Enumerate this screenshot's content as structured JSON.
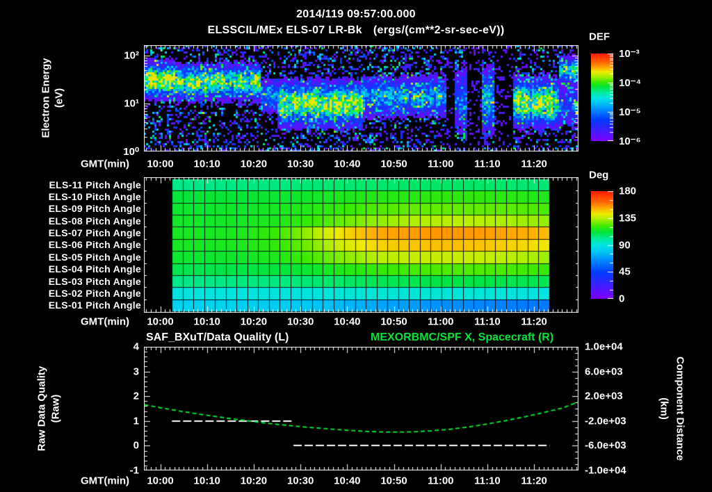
{
  "header": {
    "datetime": "2014/119 09:57:00.000",
    "instrument": "ELSSCIL/MEx ELS-07 LR-Bk",
    "units": "(ergs/(cm**2-sr-sec-eV))"
  },
  "colors": {
    "text": "#ffffff",
    "green": "#00e63c",
    "background": "#000000"
  },
  "time_axis": {
    "label": "GMT(min)",
    "tick_labels": [
      "10:00",
      "10:10",
      "10:20",
      "10:30",
      "10:40",
      "10:50",
      "11:00",
      "11:10",
      "11:20"
    ],
    "major_tick_minutes": [
      600,
      610,
      620,
      630,
      640,
      650,
      660,
      670,
      680
    ],
    "minor_tick_every_min": 1,
    "tmin_min": 596.5,
    "tmax_min": 689.5
  },
  "spectrogram_panel": {
    "ylabel_line1": "Electron Energy",
    "ylabel_line2": "(eV)",
    "ytick_labels": [
      "10²",
      "10¹",
      "10⁰"
    ],
    "ytick_decades": [
      2,
      1,
      0
    ],
    "colorbar_title": "DEF",
    "colorbar_tick_labels": [
      "10⁻³",
      "10⁻⁴",
      "10⁻⁵",
      "10⁻⁶"
    ]
  },
  "pitch_panel": {
    "row_labels": [
      "ELS-11 Pitch Angle",
      "ELS-10 Pitch Angle",
      "ELS-09 Pitch Angle",
      "ELS-08 Pitch Angle",
      "ELS-07 Pitch Angle",
      "ELS-06 Pitch Angle",
      "ELS-05 Pitch Angle",
      "ELS-04 Pitch Angle",
      "ELS-03 Pitch Angle",
      "ELS-02 Pitch Angle",
      "ELS-01 Pitch Angle"
    ],
    "colorbar_title": "Deg",
    "colorbar_tick_labels": [
      "180",
      "135",
      "90",
      "45",
      "0"
    ],
    "grid_columns": 35
  },
  "bottom_panel": {
    "title_left": "SAF_BXuT/Data Quality (L)",
    "title_right": "MEXORBMC/SPF X, Spacecraft (R)",
    "ylabel_left_line1": "Raw Data Quality",
    "ylabel_left_line2": "(Raw)",
    "ylabel_right_line1": "Component Distance",
    "ylabel_right_line2": "(km)",
    "left_tick_labels": [
      "4",
      "3",
      "2",
      "1",
      "0",
      "-1"
    ],
    "right_tick_labels": [
      "1.0e+04",
      "6.0e+03",
      "2.0e+03",
      "-2.0e+03",
      "-6.0e+03",
      "-1.0e+04"
    ]
  },
  "chart_data": [
    {
      "type": "heatmap",
      "id": "electron-energy-spectrogram",
      "title": "ELSSCIL/MEx ELS-07 LR-Bk",
      "z_units": "ergs/(cm**2-sr-sec-eV)",
      "x_axis": "GMT",
      "x_range_hhmm": [
        "09:57",
        "11:29"
      ],
      "y_axis": "Electron Energy (eV)",
      "y_scale": "log",
      "y_range_ev": [
        1,
        165
      ],
      "z_scale": "log",
      "z_range": [
        1e-06,
        0.001
      ],
      "features": [
        {
          "t_min": [
            596.5,
            603.0
          ],
          "energy_ev": [
            15,
            62
          ],
          "amplitude": 0.92,
          "note": "brightest yellow-green band at start"
        },
        {
          "t_min": [
            603.0,
            621.5
          ],
          "energy_ev": [
            14,
            55
          ],
          "amplitude": 0.78,
          "note": "green band ~20-50 eV"
        },
        {
          "t_min": [
            621.5,
            625.2
          ],
          "energy_ev": [
            7,
            28
          ],
          "amplitude": 0.38,
          "note": "weak cyan transition"
        },
        {
          "t_min": [
            625.2,
            643.5
          ],
          "energy_ev": [
            4,
            24
          ],
          "amplitude": 0.85,
          "note": "strong low-energy green block"
        },
        {
          "t_min": [
            643.5,
            661.4
          ],
          "energy_ev": [
            6,
            32
          ],
          "amplitude": 0.47,
          "note": "diffuse cyan-blue haze"
        },
        {
          "t_min": [
            663.1,
            665.8
          ],
          "energy_ev": [
            3,
            45
          ],
          "amplitude": 0.3,
          "note": "blue streak inside data gap"
        },
        {
          "t_min": [
            668.8,
            671.6
          ],
          "energy_ev": [
            3,
            45
          ],
          "amplitude": 0.45,
          "note": "blue-cyan streak inside data gap"
        },
        {
          "t_min": [
            675.3,
            685.4
          ],
          "energy_ev": [
            4,
            27
          ],
          "amplitude": 0.8,
          "note": "green block near end"
        },
        {
          "t_min": [
            685.4,
            689.5
          ],
          "energy_ev": [
            28,
            85
          ],
          "amplitude": 0.6,
          "note": "green patch upper right edge"
        },
        {
          "t_min": [
            685.4,
            689.5
          ],
          "energy_ev": [
            4,
            20
          ],
          "amplitude": 0.32,
          "note": "cyan lower right edge"
        }
      ],
      "data_gaps_t_min": [
        [
          661.4,
          663.1
        ],
        [
          665.8,
          668.8
        ],
        [
          671.6,
          675.3
        ]
      ]
    },
    {
      "type": "heatmap",
      "id": "pitch-angle-matrix",
      "rows": [
        "ELS-11",
        "ELS-10",
        "ELS-09",
        "ELS-08",
        "ELS-07",
        "ELS-06",
        "ELS-05",
        "ELS-04",
        "ELS-03",
        "ELS-02",
        "ELS-01"
      ],
      "units": "deg",
      "z_range": [
        0,
        180
      ],
      "data_window_min": [
        602.5,
        683.3
      ],
      "t_samples_min": [
        602.5,
        609.86,
        617.23,
        624.59,
        631.95,
        639.32,
        646.68,
        654.05,
        661.41,
        668.77,
        676.14,
        683.5
      ],
      "values_deg": [
        [
          103,
          103,
          104,
          104,
          105,
          106,
          106,
          107,
          107,
          107,
          106,
          105
        ],
        [
          112,
          113,
          113,
          114,
          115,
          117,
          118,
          119,
          120,
          120,
          119,
          117
        ],
        [
          114,
          114,
          115,
          116,
          118,
          121,
          124,
          126,
          126,
          126,
          125,
          123
        ],
        [
          115,
          115,
          116,
          117,
          121,
          127,
          131,
          134,
          135,
          135,
          133,
          131
        ],
        [
          116,
          116,
          117,
          121,
          132,
          145,
          152,
          154,
          155,
          154,
          152,
          149
        ],
        [
          116,
          116,
          117,
          120,
          128,
          139,
          146,
          148,
          149,
          148,
          146,
          143
        ],
        [
          114,
          114,
          115,
          117,
          123,
          130,
          135,
          137,
          137,
          137,
          135,
          132
        ],
        [
          110,
          110,
          111,
          112,
          114,
          118,
          121,
          123,
          124,
          124,
          123,
          121
        ],
        [
          103,
          103,
          104,
          104,
          105,
          107,
          109,
          110,
          111,
          111,
          110,
          109
        ],
        [
          91,
          91,
          91,
          91,
          91,
          92,
          92,
          92,
          92,
          92,
          91,
          90
        ],
        [
          84,
          84,
          83,
          82,
          80,
          76,
          72,
          69,
          66,
          64,
          62,
          60
        ]
      ]
    },
    {
      "type": "line",
      "id": "quality-and-spacecraft-distance",
      "series": [
        {
          "name": "SAF_BXuT/Data Quality (L)",
          "axis": "left",
          "ylim": [
            -1,
            4
          ],
          "color": "#ffffff",
          "line_style": "dashed",
          "segments": [
            {
              "t_min": [
                602.5,
                628.5
              ],
              "value": 1
            },
            {
              "t_min": [
                628.5,
                683.3
              ],
              "value": 0
            }
          ]
        },
        {
          "name": "MEXORBMC/SPF X, Spacecraft (R)",
          "axis": "right",
          "ylim": [
            -10000,
            10000
          ],
          "color": "#00e63c",
          "line_style": "dashed",
          "points_t_km": [
            [
              596.6,
              620
            ],
            [
              600,
              150
            ],
            [
              604,
              -380
            ],
            [
              608,
              -850
            ],
            [
              612,
              -1300
            ],
            [
              616,
              -1720
            ],
            [
              620,
              -2110
            ],
            [
              624,
              -2460
            ],
            [
              628,
              -2770
            ],
            [
              632,
              -3040
            ],
            [
              636,
              -3280
            ],
            [
              640,
              -3500
            ],
            [
              644,
              -3680
            ],
            [
              648,
              -3780
            ],
            [
              651,
              -3800
            ],
            [
              654,
              -3760
            ],
            [
              658,
              -3600
            ],
            [
              662,
              -3330
            ],
            [
              666,
              -2960
            ],
            [
              670,
              -2480
            ],
            [
              674,
              -1930
            ],
            [
              678,
              -1320
            ],
            [
              682,
              -650
            ],
            [
              686,
              80
            ],
            [
              689.4,
              1075
            ]
          ]
        }
      ]
    }
  ]
}
